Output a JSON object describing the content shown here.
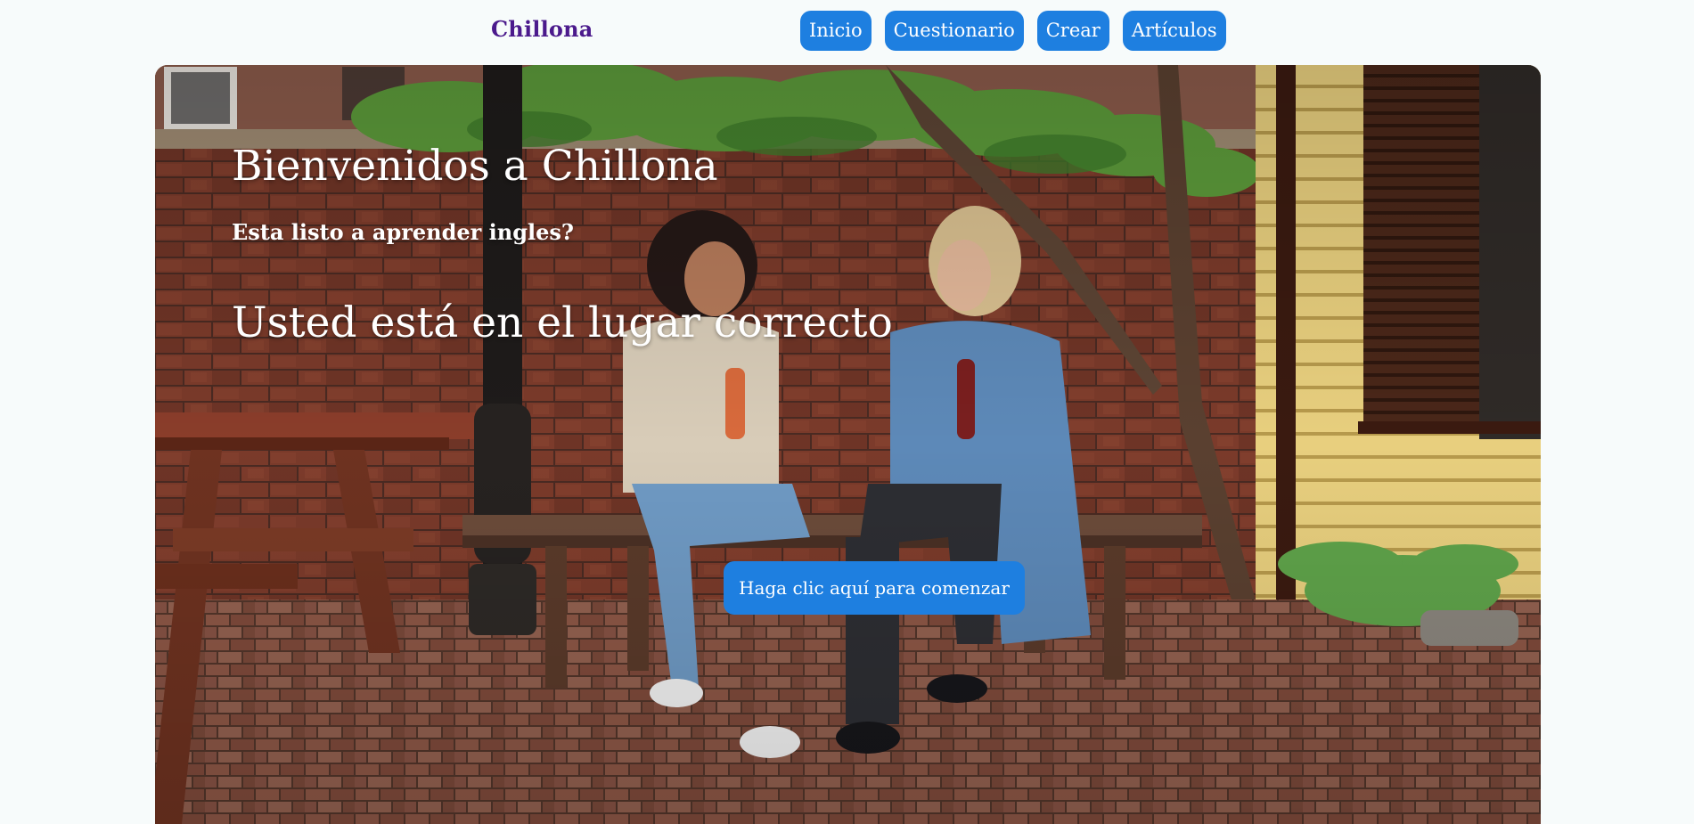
{
  "header": {
    "brand": "Chillona",
    "nav": [
      "Inicio",
      "Cuestionario",
      "Crear",
      "Artículos"
    ]
  },
  "hero": {
    "title": "Bienvenidos a Chillona",
    "subtitle": "Esta listo a aprender ingles?",
    "tagline": "Usted está en el lugar correcto",
    "cta": "Haga clic aquí para comenzar"
  },
  "colors": {
    "accent": "#1e7fe0",
    "brand": "#4b1a8c",
    "background": "#f7fbfb"
  }
}
